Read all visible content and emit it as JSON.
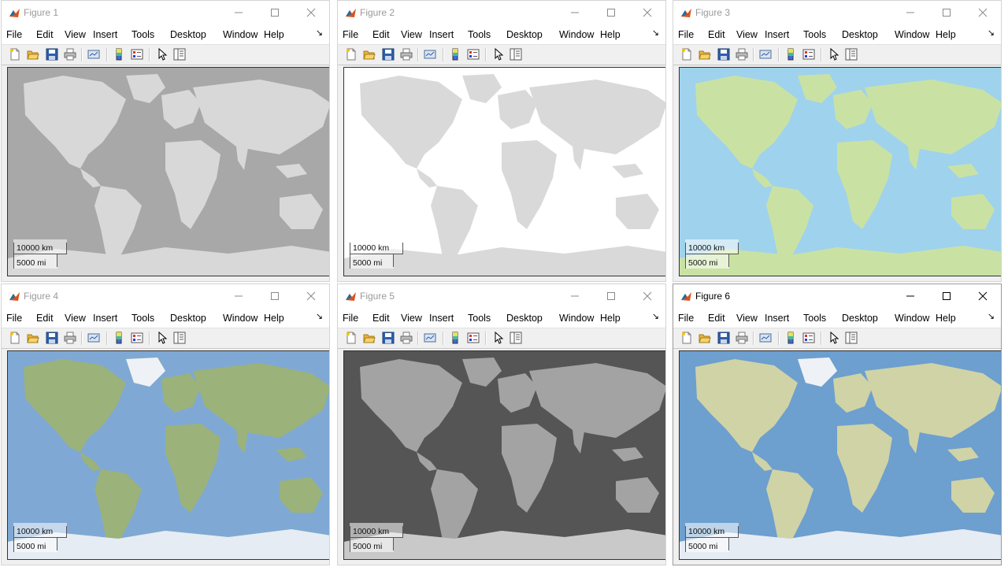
{
  "menus": [
    "File",
    "Edit",
    "View",
    "Insert",
    "Tools",
    "Desktop",
    "Window",
    "Help"
  ],
  "menu_overflow": "↘",
  "toolbar_icons": [
    "new-figure-icon",
    "open-file-icon",
    "save-icon",
    "print-icon",
    "link-plot-icon",
    "insert-colorbar-icon",
    "insert-legend-icon",
    "edit-plot-icon",
    "property-inspector-icon"
  ],
  "window_controls": [
    "minimize-icon",
    "maximize-icon",
    "close-icon"
  ],
  "scale_bar": {
    "km": "10000 km",
    "mi": "5000 mi"
  },
  "figures": [
    {
      "title": "Figure 1",
      "basemap": "darkwater",
      "active": false,
      "ocean": "#a8a8a8",
      "land": "#d8d8d8"
    },
    {
      "title": "Figure 2",
      "basemap": "grayland",
      "active": false,
      "ocean": "#ffffff",
      "land": "#d9d9d9"
    },
    {
      "title": "Figure 3",
      "basemap": "bluegreen",
      "active": false,
      "ocean": "#9fd2ec",
      "land": "#c9e2a4"
    },
    {
      "title": "Figure 4",
      "basemap": "landcover",
      "active": false,
      "ocean": "#7fa9d4",
      "land": "#9bb27a"
    },
    {
      "title": "Figure 5",
      "basemap": "grayterrain",
      "active": false,
      "ocean": "#555555",
      "land": "#a3a3a3"
    },
    {
      "title": "Figure 6",
      "basemap": "colorterrain",
      "active": true,
      "ocean": "#6d9fcf",
      "land": "#cfd3a6"
    }
  ]
}
